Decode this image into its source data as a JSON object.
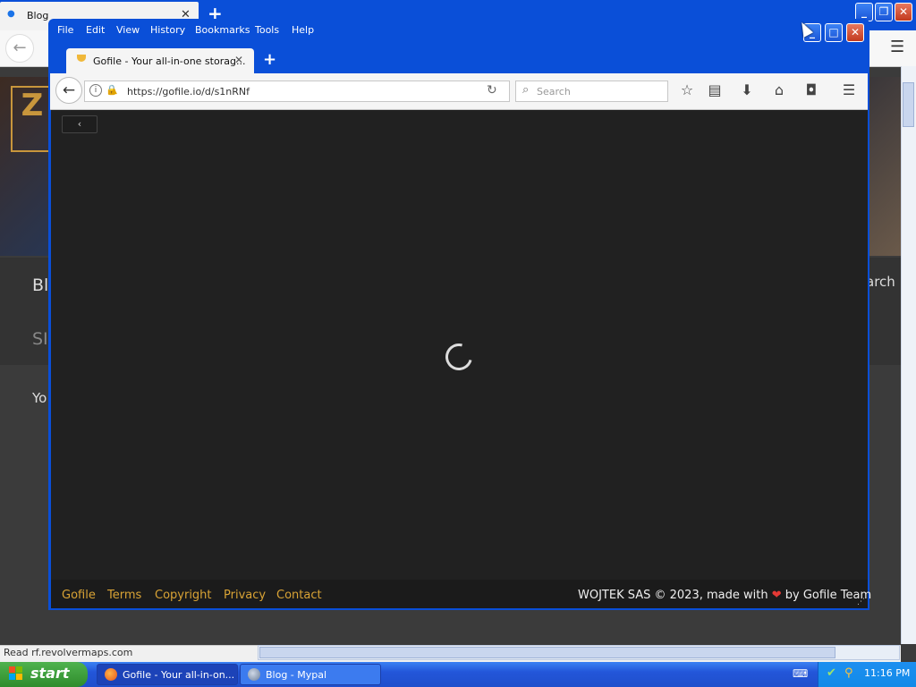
{
  "background_window": {
    "tab_title": "Blog",
    "nav_blog": "Bl",
    "nav_search": "arch",
    "nav_sub": "SI",
    "body_text": "Yo",
    "status_text": "Read rf.revolvermaps.com",
    "logo_letter": "Z"
  },
  "front_window": {
    "menu": [
      "File",
      "Edit",
      "View",
      "History",
      "Bookmarks",
      "Tools",
      "Help"
    ],
    "tab_title": "Gofile - Your all-in-one storag...",
    "url": "https://gofile.io/d/s1nRNf",
    "search_placeholder": "Search",
    "collapse_glyph": "‹",
    "footer": {
      "links": [
        "Gofile",
        "Terms",
        "Copyright",
        "Privacy",
        "Contact"
      ],
      "credit_prefix": "WOJTEK SAS © 2023, made with",
      "credit_suffix": "by Gofile Team"
    }
  },
  "taskbar": {
    "start_label": "start",
    "tasks": [
      "Gofile - Your all-in-on...",
      "Blog - Mypal"
    ],
    "clock": "11:16 PM"
  },
  "colors": {
    "xp_blue": "#0a4fd8",
    "gofile_bg": "#212121",
    "footer_link": "#d9a335",
    "heart": "#e53935",
    "start_green": "#3a9e37"
  },
  "icons": [
    "back-arrow-icon",
    "info-icon",
    "lock-icon",
    "warning-icon",
    "reload-icon",
    "search-icon",
    "bookmark-star-icon",
    "reading-list-icon",
    "download-icon",
    "home-icon",
    "pocket-icon",
    "hamburger-menu-icon",
    "heart-icon",
    "windows-logo-icon"
  ]
}
